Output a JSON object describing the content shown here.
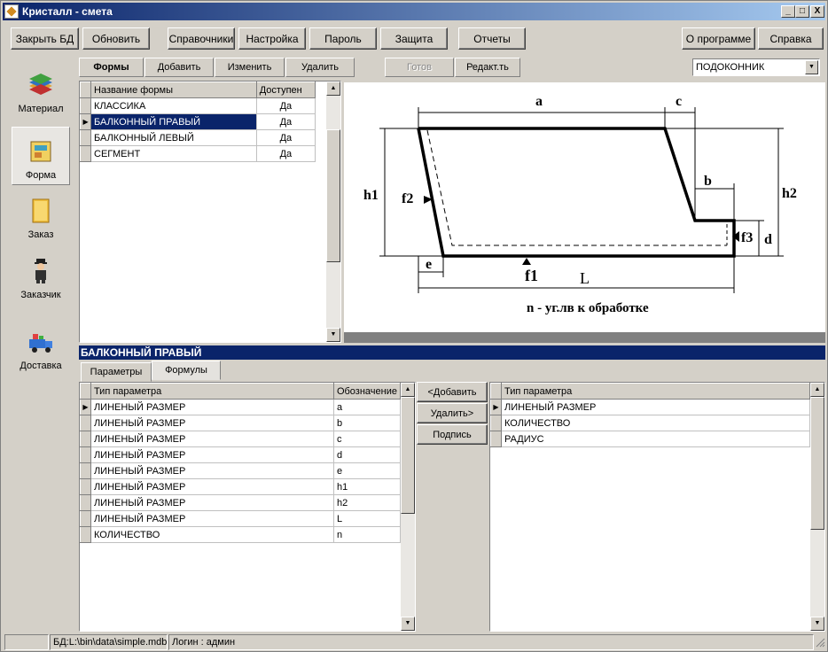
{
  "window": {
    "title": "Кристалл - смета",
    "min_label": "_",
    "max_label": "□",
    "close_label": "X"
  },
  "toolbar": {
    "close_db": "Закрыть БД",
    "refresh": "Обновить",
    "refs": "Справочники",
    "settings": "Настройка",
    "password": "Пароль",
    "protection": "Защита",
    "reports": "Отчеты",
    "about": "О программе",
    "help": "Справка"
  },
  "sidebar": {
    "items": [
      {
        "label": "Материал",
        "icon": "books-icon"
      },
      {
        "label": "Форма",
        "icon": "shape-icon"
      },
      {
        "label": "Заказ",
        "icon": "order-icon"
      },
      {
        "label": "Заказчик",
        "icon": "customer-icon"
      },
      {
        "label": "Доставка",
        "icon": "delivery-icon"
      }
    ]
  },
  "forms_toolbar": {
    "title": "Формы",
    "add": "Добавить",
    "edit": "Изменить",
    "delete": "Удалить",
    "ready": "Готов",
    "editor": "Редакт.ть"
  },
  "combo": {
    "value": "ПОДОКОННИК",
    "arrow": "▼"
  },
  "forms_grid": {
    "headers": [
      "Название формы",
      "Доступен"
    ],
    "rows": [
      {
        "name": "КЛАССИКА",
        "avail": "Да"
      },
      {
        "name": "БАЛКОННЫЙ ПРАВЫЙ",
        "avail": "Да"
      },
      {
        "name": "БАЛКОННЫЙ ЛЕВЫЙ",
        "avail": "Да"
      },
      {
        "name": "СЕГМЕНТ",
        "avail": "Да"
      }
    ],
    "selected_row": 1
  },
  "drawing": {
    "labels": {
      "a": "a",
      "c": "c",
      "b": "b",
      "h1": "h1",
      "f2": "f2",
      "h2": "h2",
      "f3": "f3",
      "d": "d",
      "e": "e",
      "f1": "f1",
      "L": "L"
    },
    "caption": "n - уг.лв к обработке"
  },
  "detail": {
    "title": "БАЛКОННЫЙ ПРАВЫЙ",
    "tabs": [
      "Параметры",
      "Формулы"
    ],
    "params_grid": {
      "headers": [
        "Тип параметра",
        "Обозначение"
      ],
      "rows": [
        {
          "type": "ЛИНЕНЫЙ РАЗМЕР",
          "sym": "a"
        },
        {
          "type": "ЛИНЕНЫЙ РАЗМЕР",
          "sym": "b"
        },
        {
          "type": "ЛИНЕНЫЙ РАЗМЕР",
          "sym": "c"
        },
        {
          "type": "ЛИНЕНЫЙ РАЗМЕР",
          "sym": "d"
        },
        {
          "type": "ЛИНЕНЫЙ РАЗМЕР",
          "sym": "e"
        },
        {
          "type": "ЛИНЕНЫЙ РАЗМЕР",
          "sym": "h1"
        },
        {
          "type": "ЛИНЕНЫЙ РАЗМЕР",
          "sym": "h2"
        },
        {
          "type": "ЛИНЕНЫЙ РАЗМЕР",
          "sym": "L"
        },
        {
          "type": "КОЛИЧЕСТВО",
          "sym": "n"
        }
      ]
    },
    "mid_buttons": {
      "add": "<Добавить",
      "remove": "Удалить>",
      "caption": "Подпись"
    },
    "types_grid": {
      "headers": [
        "Тип параметра"
      ],
      "rows": [
        "ЛИНЕНЫЙ РАЗМЕР",
        "КОЛИЧЕСТВО",
        "РАДИУС"
      ]
    }
  },
  "status": {
    "db": "БД:L:\\bin\\data\\simple.mdb",
    "login": "Логин : админ"
  }
}
